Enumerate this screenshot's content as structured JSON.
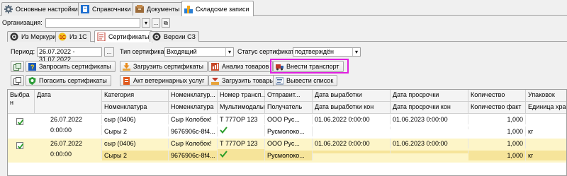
{
  "top_tabs": [
    {
      "label": "Основные настройки",
      "icon": "gear-icon"
    },
    {
      "label": "Справочники",
      "icon": "book-icon"
    },
    {
      "label": "Документы",
      "icon": "documents-icon"
    },
    {
      "label": "Складские записи",
      "icon": "warehouse-icon"
    }
  ],
  "org": {
    "label": "Организация:",
    "value": "",
    "dropdown_glyph": "▾",
    "choose_glyph": "...",
    "open_glyph": "⧉"
  },
  "inner_tabs": [
    {
      "label": "Из Меркурий",
      "icon": "mercury-icon"
    },
    {
      "label": "Из 1С",
      "icon": "onec-icon"
    },
    {
      "label": "Сертификаты",
      "icon": "certificate-icon"
    },
    {
      "label": "Версии СЗ",
      "icon": "versions-icon"
    }
  ],
  "filters": {
    "period_label": "Период:",
    "period_value": "26.07.2022 - 31.07.2022",
    "period_btn": "...",
    "cert_type_label": "Тип сертификата:",
    "cert_type_value": "Входящий",
    "status_label": "Статус сертификата:",
    "status_value": "подтверждён",
    "dropdown_glyph": "▾"
  },
  "toolbar": {
    "row1": [
      "Запросить сертификаты",
      "Загрузить сертификаты",
      "Анализ товаров",
      "Внести транспорт"
    ],
    "row2": [
      "Погасить сертификаты",
      "Акт ветеринарных услуг",
      "Загрузить товары",
      "Вывести список"
    ]
  },
  "table": {
    "headers_top": [
      "Выбра н",
      "Дата",
      "Категория",
      "Номенклатур...",
      "Номер трансп...",
      "Отправит...",
      "Дата выработки",
      "Дата просрочки",
      "Количество",
      "Упаковок"
    ],
    "headers_bottom": [
      "",
      "",
      "Номенклатура",
      "Номенклатура",
      "Мультимодальн",
      "Получатель",
      "Дата выработки кон",
      "Дата просрочки кон",
      "Количество факт",
      "Единица хран"
    ],
    "rows": [
      {
        "selected": true,
        "date": "26.07.2022",
        "time": "0:00:00",
        "category": "сыр (0406)",
        "category2": "Сыры 2",
        "nomenclature": "Сыр Колобок!",
        "nomenclature2": "9676906c-8f4...",
        "transport": "Т 777ОР 123",
        "multimodal": true,
        "sender": "ООО Рус...",
        "receiver": "Русмолоко...",
        "prod_date": "01.06.2022 0:00:00",
        "prod_date_end": "",
        "exp_date": "01.06.2023 0:00:00",
        "exp_date_end": "",
        "qty": "1,000",
        "qty_fact": "1,000",
        "packages": "",
        "unit": "кг"
      },
      {
        "selected": true,
        "date": "26.07.2022",
        "time": "0:00:00",
        "category": "сыр (0406)",
        "category2": "Сыры 2",
        "nomenclature": "Сыр Колобок!",
        "nomenclature2": "9676906c-8f4...",
        "transport": "Т 777ОР 123",
        "multimodal": true,
        "sender": "ООО Рус...",
        "receiver": "Русмолоко...",
        "prod_date": "01.06.2022 0:00:00",
        "prod_date_end": "",
        "exp_date": "01.06.2023 0:00:00",
        "exp_date_end": "",
        "qty": "1,000",
        "qty_fact": "1,000",
        "packages": "",
        "unit": "кг"
      }
    ]
  },
  "colors": {
    "selected_row": "#fdf5c8",
    "highlight": "#e020e0",
    "check": "#2a9d2a"
  }
}
